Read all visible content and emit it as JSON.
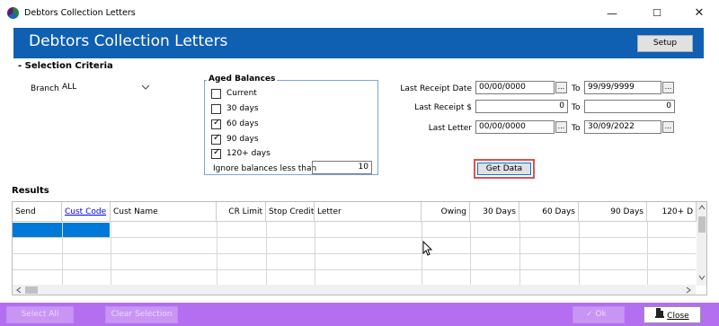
{
  "window": {
    "title": "Debtors Collection Letters",
    "min_glyph": "—",
    "max_glyph": "☐",
    "close_glyph": "✕"
  },
  "header": {
    "title": "Debtors Collection Letters",
    "setup_label": "Setup"
  },
  "selection": {
    "heading": "- Selection Criteria",
    "branch_label": "Branch",
    "branch_value": "ALL"
  },
  "aged": {
    "title": "Aged Balances",
    "options": [
      {
        "label": "Current",
        "checked": false
      },
      {
        "label": "30 days",
        "checked": false
      },
      {
        "label": "60 days",
        "checked": true
      },
      {
        "label": "90 days",
        "checked": true
      },
      {
        "label": "120+ days",
        "checked": true
      }
    ],
    "ignore_label": "Ignore balances less than",
    "ignore_value": "10"
  },
  "criteria": {
    "last_receipt_date_label": "Last Receipt Date",
    "last_receipt_date_from": "00/00/0000",
    "last_receipt_date_to": "99/99/9999",
    "last_receipt_amt_label": "Last Receipt $",
    "last_receipt_amt_from": "0",
    "last_receipt_amt_to": "0",
    "last_letter_label": "Last Letter",
    "last_letter_from": "00/00/0000",
    "last_letter_to": "30/09/2022",
    "to_label": "To",
    "dots": "...",
    "get_data_label": "Get Data"
  },
  "results": {
    "heading": "Results",
    "columns": [
      "Send",
      "Cust Code",
      "Cust Name",
      "CR Limit",
      "Stop Credit",
      "Letter",
      "Owing",
      "30 Days",
      "60 Days",
      "90 Days",
      "120+ D"
    ]
  },
  "footer": {
    "select_all": "Select All",
    "clear_selection": "Clear Selection",
    "ok": "Ok",
    "close": "Close"
  },
  "colors": {
    "header_blue": "#0f5fb3",
    "footer_purple": "#b46ff0",
    "selection_blue": "#0078d7",
    "highlight_red": "#d9534f"
  }
}
